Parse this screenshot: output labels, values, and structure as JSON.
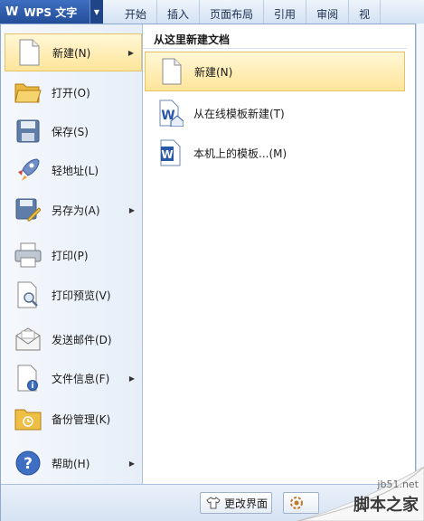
{
  "app": {
    "logo": "W",
    "title": "WPS 文字"
  },
  "tabs": [
    "开始",
    "插入",
    "页面布局",
    "引用",
    "审阅",
    "视"
  ],
  "left_menu": [
    {
      "label": "新建(N)",
      "icon": "new-doc-icon",
      "submenu": true,
      "active": true
    },
    {
      "label": "打开(O)",
      "icon": "open-folder-icon",
      "submenu": false
    },
    {
      "label": "保存(S)",
      "icon": "save-disk-icon",
      "submenu": false
    },
    {
      "label": "轻地址(L)",
      "icon": "rocket-icon",
      "submenu": false
    },
    {
      "label": "另存为(A)",
      "icon": "save-as-icon",
      "submenu": true
    },
    {
      "label": "打印(P)",
      "icon": "printer-icon",
      "submenu": false
    },
    {
      "label": "打印预览(V)",
      "icon": "print-preview-icon",
      "submenu": false
    },
    {
      "label": "发送邮件(D)",
      "icon": "mail-icon",
      "submenu": false
    },
    {
      "label": "文件信息(F)",
      "icon": "file-info-icon",
      "submenu": true
    },
    {
      "label": "备份管理(K)",
      "icon": "backup-folder-icon",
      "submenu": false
    },
    {
      "label": "帮助(H)",
      "icon": "help-icon",
      "submenu": true
    }
  ],
  "right_panel": {
    "title": "从这里新建文档",
    "items": [
      {
        "label": "新建(N)",
        "icon": "blank-doc-icon",
        "active": true
      },
      {
        "label": "从在线模板新建(T)",
        "icon": "online-template-icon"
      },
      {
        "label": "本机上的模板...(M)",
        "icon": "local-template-icon"
      }
    ]
  },
  "footer": {
    "change_ui_label": "更改界面"
  },
  "watermark": {
    "site": "jb51.net",
    "brand": "脚本之家"
  },
  "colors": {
    "accent": "#2a58a8",
    "highlight": "#ffe59a",
    "highlight_border": "#e5c365"
  }
}
